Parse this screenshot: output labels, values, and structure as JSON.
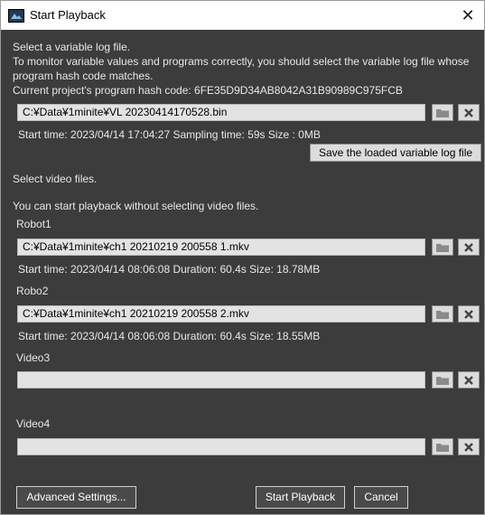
{
  "window": {
    "title": "Start Playback",
    "close_glyph": "✕"
  },
  "log": {
    "section_label": "Select a variable log file.",
    "info_line1": "To monitor variable values and programs correctly, you should select the variable log file whose",
    "info_line2": "program hash code matches.",
    "hash_line": "Current project's program hash code:  6FE35D9D34AB8042A31B90989C975FCB",
    "path": "C:¥Data¥1minite¥VL  20230414170528.bin",
    "details": "Start time: 2023/04/14 17:04:27    Sampling time: 59s    Size : 0MB",
    "save_button": "Save the loaded variable log file"
  },
  "video": {
    "section_label": "Select video files.",
    "hint": "You can start playback without selecting video files.",
    "slots": [
      {
        "label": "Robot1",
        "path": "C:¥Data¥1minite¥ch1  20210219  200558  1.mkv",
        "details": "Start time: 2023/04/14 08:06:08        Duration: 60.4s    Size: 18.78MB"
      },
      {
        "label": "Robo2",
        "path": "C:¥Data¥1minite¥ch1  20210219  200558  2.mkv",
        "details": "Start time: 2023/04/14 08:06:08        Duration: 60.4s    Size: 18.55MB"
      },
      {
        "label": "Video3",
        "path": "",
        "details": ""
      },
      {
        "label": "Video4",
        "path": "",
        "details": ""
      }
    ]
  },
  "buttons": {
    "advanced": "Advanced Settings...",
    "start": "Start Playback",
    "cancel": "Cancel"
  },
  "icons": {
    "folder": "folder-icon",
    "clear": "clear-x-icon"
  }
}
